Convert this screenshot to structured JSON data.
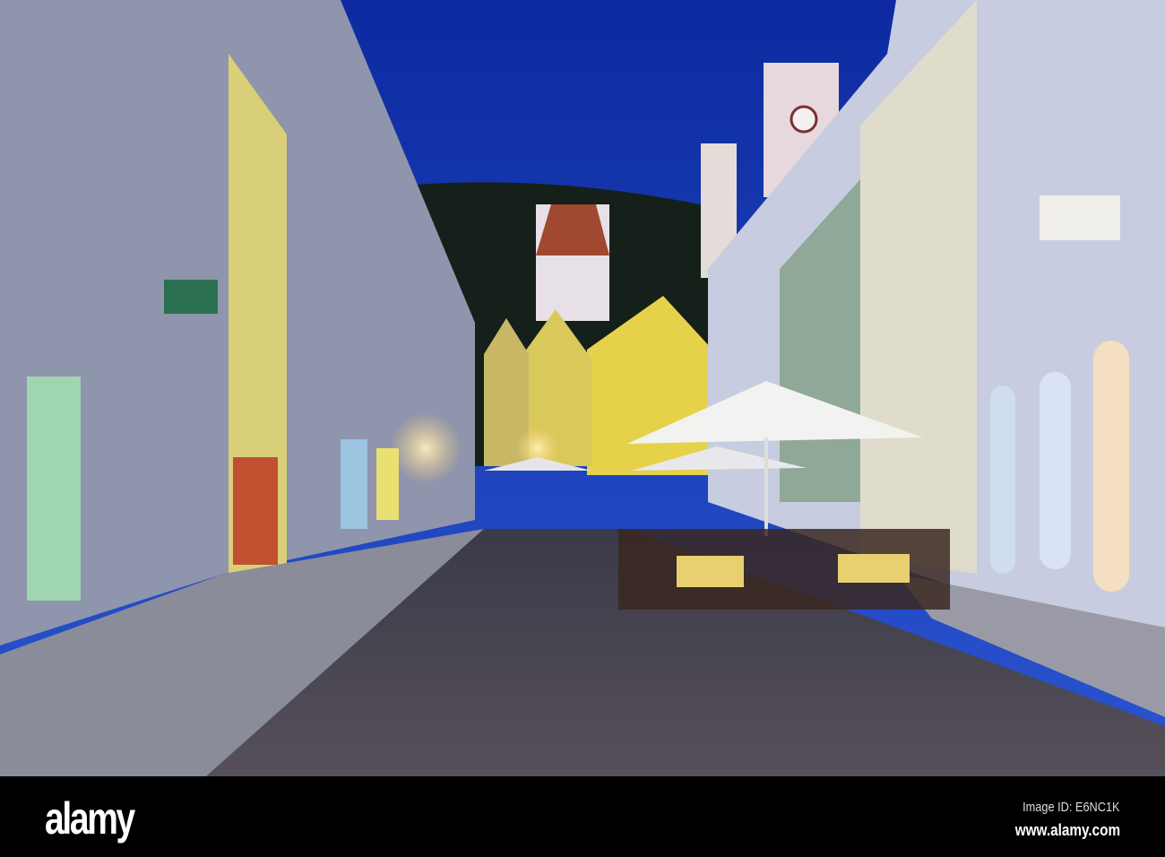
{
  "watermark": {
    "logo": "alamy",
    "image_id": "Image ID: E6NC1K",
    "site": "www.alamy.com"
  },
  "colors": {
    "sky": "#1a3fb8",
    "street": "#4a4550",
    "sidewalk": "#8a8c9a",
    "lit_facade": "#e6d24a",
    "umbrella": "#f2f2f0"
  }
}
